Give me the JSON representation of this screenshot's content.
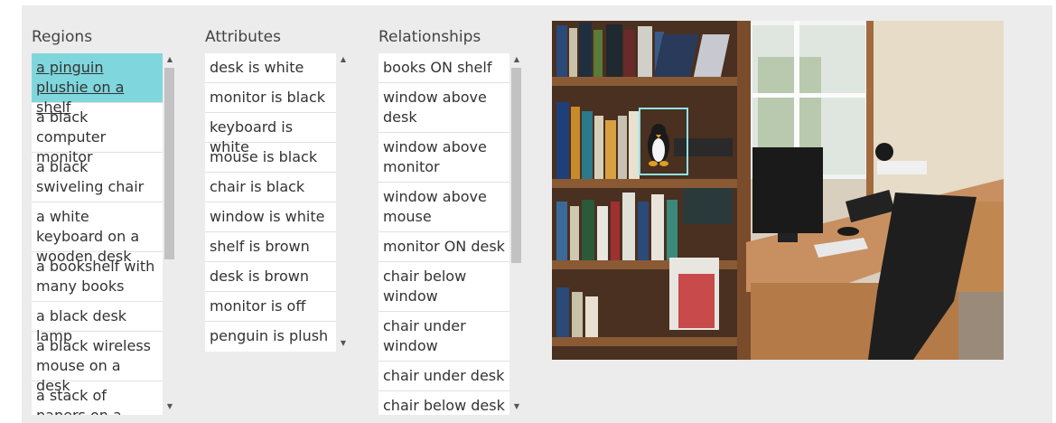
{
  "regions": {
    "title": "Regions",
    "items": [
      "a pinguin plushie on a shelf",
      "a black computer monitor",
      "a black swiveling chair",
      "a white keyboard on a wooden desk",
      "a bookshelf with many books",
      "a black desk lamp",
      "a black wireless mouse on a desk",
      "a stack of papers on a desk"
    ]
  },
  "attributes": {
    "title": "Attributes",
    "items": [
      "desk is white",
      "monitor is black",
      "keyboard is white",
      "mouse is black",
      "chair is black",
      "window is white",
      "shelf is brown",
      "desk is brown",
      "monitor is off",
      "penguin is plush"
    ]
  },
  "relationships": {
    "title": "Relationships",
    "items": [
      "books ON shelf",
      "window above desk",
      "window above monitor",
      "window above mouse",
      "monitor ON desk",
      "chair below window",
      "chair under window",
      "chair under desk",
      "chair below desk"
    ]
  },
  "icons": {
    "scroll_up": "scroll-up-arrow-icon",
    "scroll_down": "scroll-down-arrow-icon"
  },
  "colors": {
    "selected_bg": "#7fd7dd",
    "highlight_box": "#8fe3e8",
    "panel_bg": "#ececec"
  }
}
